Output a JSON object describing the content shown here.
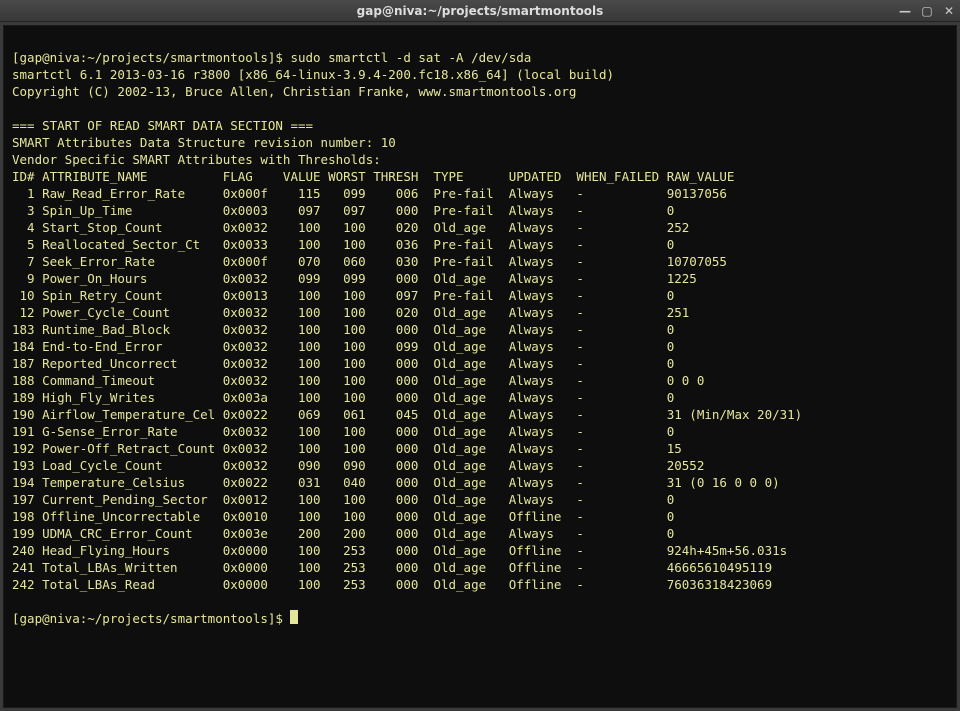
{
  "window": {
    "title": "gap@niva:~/projects/smartmontools"
  },
  "prompt1": "[gap@niva:~/projects/smartmontools]$ ",
  "command": "sudo smartctl -d sat -A /dev/sda",
  "version_line": "smartctl 6.1 2013-03-16 r3800 [x86_64-linux-3.9.4-200.fc18.x86_64] (local build)",
  "copyright_line": "Copyright (C) 2002-13, Bruce Allen, Christian Franke, www.smartmontools.org",
  "section_header": "=== START OF READ SMART DATA SECTION ===",
  "rev_line": "SMART Attributes Data Structure revision number: 10",
  "vendor_line": "Vendor Specific SMART Attributes with Thresholds:",
  "columns": {
    "id": "ID#",
    "name": "ATTRIBUTE_NAME",
    "flag": "FLAG",
    "value": "VALUE",
    "worst": "WORST",
    "thresh": "THRESH",
    "type": "TYPE",
    "updated": "UPDATED",
    "when": "WHEN_FAILED",
    "raw": "RAW_VALUE"
  },
  "rows": [
    {
      "id": "1",
      "name": "Raw_Read_Error_Rate",
      "flag": "0x000f",
      "value": "115",
      "worst": "099",
      "thresh": "006",
      "type": "Pre-fail",
      "updated": "Always",
      "when": "-",
      "raw": "90137056"
    },
    {
      "id": "3",
      "name": "Spin_Up_Time",
      "flag": "0x0003",
      "value": "097",
      "worst": "097",
      "thresh": "000",
      "type": "Pre-fail",
      "updated": "Always",
      "when": "-",
      "raw": "0"
    },
    {
      "id": "4",
      "name": "Start_Stop_Count",
      "flag": "0x0032",
      "value": "100",
      "worst": "100",
      "thresh": "020",
      "type": "Old_age",
      "updated": "Always",
      "when": "-",
      "raw": "252"
    },
    {
      "id": "5",
      "name": "Reallocated_Sector_Ct",
      "flag": "0x0033",
      "value": "100",
      "worst": "100",
      "thresh": "036",
      "type": "Pre-fail",
      "updated": "Always",
      "when": "-",
      "raw": "0"
    },
    {
      "id": "7",
      "name": "Seek_Error_Rate",
      "flag": "0x000f",
      "value": "070",
      "worst": "060",
      "thresh": "030",
      "type": "Pre-fail",
      "updated": "Always",
      "when": "-",
      "raw": "10707055"
    },
    {
      "id": "9",
      "name": "Power_On_Hours",
      "flag": "0x0032",
      "value": "099",
      "worst": "099",
      "thresh": "000",
      "type": "Old_age",
      "updated": "Always",
      "when": "-",
      "raw": "1225"
    },
    {
      "id": "10",
      "name": "Spin_Retry_Count",
      "flag": "0x0013",
      "value": "100",
      "worst": "100",
      "thresh": "097",
      "type": "Pre-fail",
      "updated": "Always",
      "when": "-",
      "raw": "0"
    },
    {
      "id": "12",
      "name": "Power_Cycle_Count",
      "flag": "0x0032",
      "value": "100",
      "worst": "100",
      "thresh": "020",
      "type": "Old_age",
      "updated": "Always",
      "when": "-",
      "raw": "251"
    },
    {
      "id": "183",
      "name": "Runtime_Bad_Block",
      "flag": "0x0032",
      "value": "100",
      "worst": "100",
      "thresh": "000",
      "type": "Old_age",
      "updated": "Always",
      "when": "-",
      "raw": "0"
    },
    {
      "id": "184",
      "name": "End-to-End_Error",
      "flag": "0x0032",
      "value": "100",
      "worst": "100",
      "thresh": "099",
      "type": "Old_age",
      "updated": "Always",
      "when": "-",
      "raw": "0"
    },
    {
      "id": "187",
      "name": "Reported_Uncorrect",
      "flag": "0x0032",
      "value": "100",
      "worst": "100",
      "thresh": "000",
      "type": "Old_age",
      "updated": "Always",
      "when": "-",
      "raw": "0"
    },
    {
      "id": "188",
      "name": "Command_Timeout",
      "flag": "0x0032",
      "value": "100",
      "worst": "100",
      "thresh": "000",
      "type": "Old_age",
      "updated": "Always",
      "when": "-",
      "raw": "0 0 0"
    },
    {
      "id": "189",
      "name": "High_Fly_Writes",
      "flag": "0x003a",
      "value": "100",
      "worst": "100",
      "thresh": "000",
      "type": "Old_age",
      "updated": "Always",
      "when": "-",
      "raw": "0"
    },
    {
      "id": "190",
      "name": "Airflow_Temperature_Cel",
      "flag": "0x0022",
      "value": "069",
      "worst": "061",
      "thresh": "045",
      "type": "Old_age",
      "updated": "Always",
      "when": "-",
      "raw": "31 (Min/Max 20/31)"
    },
    {
      "id": "191",
      "name": "G-Sense_Error_Rate",
      "flag": "0x0032",
      "value": "100",
      "worst": "100",
      "thresh": "000",
      "type": "Old_age",
      "updated": "Always",
      "when": "-",
      "raw": "0"
    },
    {
      "id": "192",
      "name": "Power-Off_Retract_Count",
      "flag": "0x0032",
      "value": "100",
      "worst": "100",
      "thresh": "000",
      "type": "Old_age",
      "updated": "Always",
      "when": "-",
      "raw": "15"
    },
    {
      "id": "193",
      "name": "Load_Cycle_Count",
      "flag": "0x0032",
      "value": "090",
      "worst": "090",
      "thresh": "000",
      "type": "Old_age",
      "updated": "Always",
      "when": "-",
      "raw": "20552"
    },
    {
      "id": "194",
      "name": "Temperature_Celsius",
      "flag": "0x0022",
      "value": "031",
      "worst": "040",
      "thresh": "000",
      "type": "Old_age",
      "updated": "Always",
      "when": "-",
      "raw": "31 (0 16 0 0 0)"
    },
    {
      "id": "197",
      "name": "Current_Pending_Sector",
      "flag": "0x0012",
      "value": "100",
      "worst": "100",
      "thresh": "000",
      "type": "Old_age",
      "updated": "Always",
      "when": "-",
      "raw": "0"
    },
    {
      "id": "198",
      "name": "Offline_Uncorrectable",
      "flag": "0x0010",
      "value": "100",
      "worst": "100",
      "thresh": "000",
      "type": "Old_age",
      "updated": "Offline",
      "when": "-",
      "raw": "0"
    },
    {
      "id": "199",
      "name": "UDMA_CRC_Error_Count",
      "flag": "0x003e",
      "value": "200",
      "worst": "200",
      "thresh": "000",
      "type": "Old_age",
      "updated": "Always",
      "when": "-",
      "raw": "0"
    },
    {
      "id": "240",
      "name": "Head_Flying_Hours",
      "flag": "0x0000",
      "value": "100",
      "worst": "253",
      "thresh": "000",
      "type": "Old_age",
      "updated": "Offline",
      "when": "-",
      "raw": "924h+45m+56.031s"
    },
    {
      "id": "241",
      "name": "Total_LBAs_Written",
      "flag": "0x0000",
      "value": "100",
      "worst": "253",
      "thresh": "000",
      "type": "Old_age",
      "updated": "Offline",
      "when": "-",
      "raw": "46665610495119"
    },
    {
      "id": "242",
      "name": "Total_LBAs_Read",
      "flag": "0x0000",
      "value": "100",
      "worst": "253",
      "thresh": "000",
      "type": "Old_age",
      "updated": "Offline",
      "when": "-",
      "raw": "76036318423069"
    }
  ],
  "prompt2": "[gap@niva:~/projects/smartmontools]$ "
}
